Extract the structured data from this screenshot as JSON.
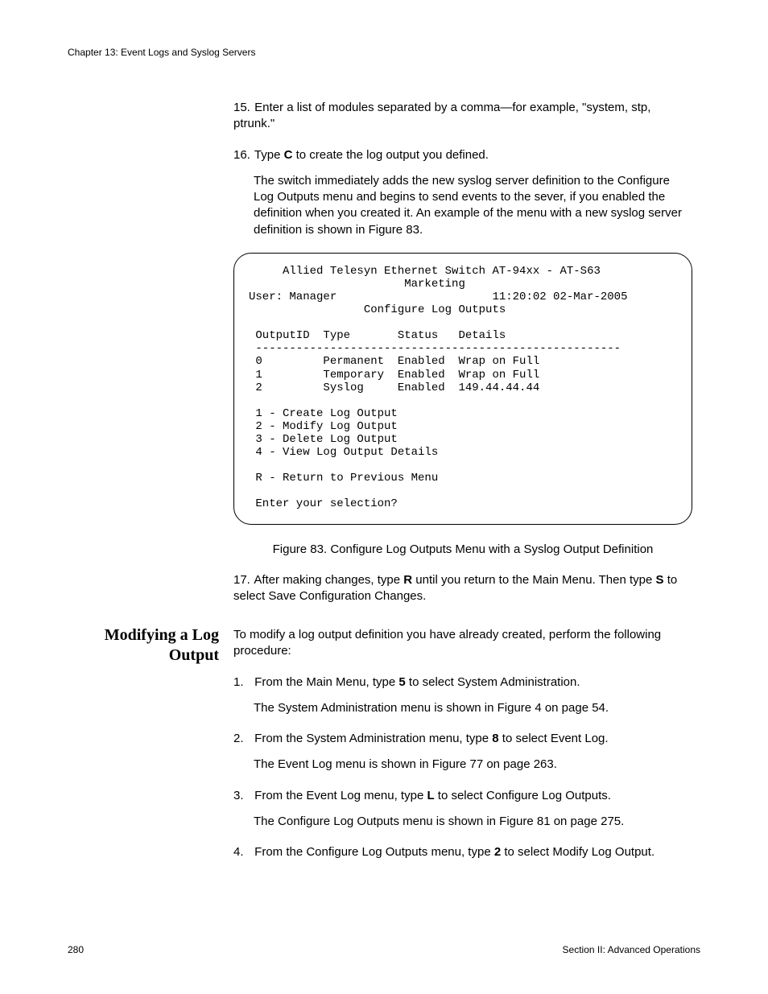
{
  "header": {
    "chapter": "Chapter 13: Event Logs and Syslog Servers"
  },
  "steps_a": {
    "s15_num": "15.",
    "s15_a": "Enter a list of modules separated by a comma—for example, \"system, stp, ptrunk.\"",
    "s16_num": "16.",
    "s16_a": "Type ",
    "s16_b": "C",
    "s16_c": " to create the log output you defined.",
    "s16_para": "The switch immediately adds the new syslog server definition to the Configure Log Outputs menu and begins to send events to the sever, if you enabled the definition when you created it. An example of the menu with a new syslog server definition is shown in Figure 83."
  },
  "terminal": {
    "line1": "     Allied Telesyn Ethernet Switch AT-94xx - AT-S63",
    "line2": "                       Marketing",
    "line3": "User: Manager                       11:20:02 02-Mar-2005",
    "line4": "                 Configure Log Outputs",
    "blank": "",
    "hdr": " OutputID  Type       Status   Details",
    "rule": " ------------------------------------------------------",
    "row0": " 0         Permanent  Enabled  Wrap on Full",
    "row1": " 1         Temporary  Enabled  Wrap on Full",
    "row2": " 2         Syslog     Enabled  149.44.44.44",
    "m1": " 1 - Create Log Output",
    "m2": " 2 - Modify Log Output",
    "m3": " 3 - Delete Log Output",
    "m4": " 4 - View Log Output Details",
    "mr": " R - Return to Previous Menu",
    "prompt": " Enter your selection?"
  },
  "figure_caption": "Figure 83. Configure Log Outputs Menu with a Syslog Output Definition",
  "steps_b": {
    "s17_num": "17.",
    "s17_a": "After making changes, type ",
    "s17_b": "R",
    "s17_c": " until you return to the Main Menu. Then type ",
    "s17_d": "S",
    "s17_e": " to select Save Configuration Changes."
  },
  "section": {
    "heading": "Modifying a Log Output",
    "intro": "To modify a log output definition you have already created, perform the following procedure:",
    "p1_num": "1.",
    "p1_a": "From the Main Menu, type ",
    "p1_b": "5",
    "p1_c": " to select System Administration.",
    "p1_sub": "The System Administration menu is shown in Figure 4 on page 54.",
    "p2_num": "2.",
    "p2_a": "From the System Administration menu, type ",
    "p2_b": "8",
    "p2_c": " to select Event Log.",
    "p2_sub": "The Event Log menu is shown in Figure 77 on page 263.",
    "p3_num": "3.",
    "p3_a": "From the Event Log menu, type ",
    "p3_b": "L",
    "p3_c": " to select Configure Log Outputs.",
    "p3_sub": "The Configure Log Outputs menu is shown in Figure 81 on page 275.",
    "p4_num": "4.",
    "p4_a": "From the Configure Log Outputs menu, type ",
    "p4_b": "2",
    "p4_c": " to select Modify Log Output."
  },
  "footer": {
    "page": "280",
    "section": "Section II: Advanced Operations"
  }
}
